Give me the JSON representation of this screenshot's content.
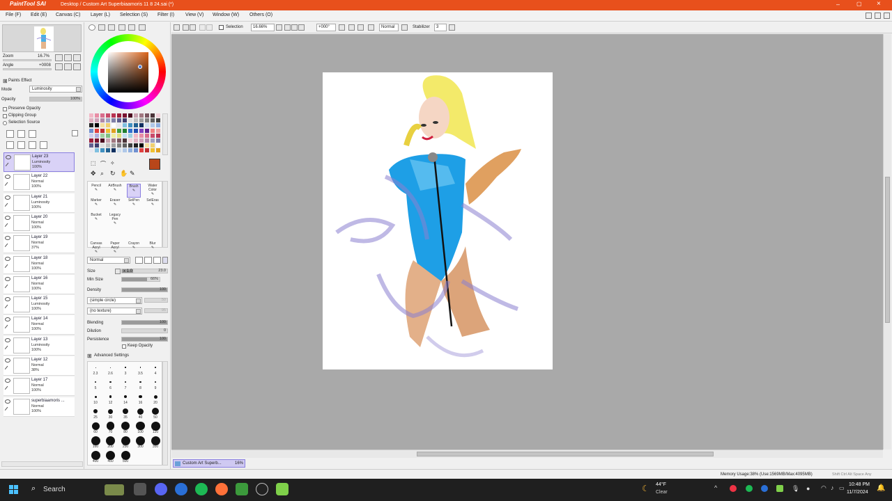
{
  "window": {
    "title": "Desktop / Custom Art Superbiaamoris 11 8 24.sai (*)",
    "logo": "PaintTool SAI"
  },
  "menu": [
    "File (F)",
    "Edit (E)",
    "Canvas (C)",
    "Layer (L)",
    "Selection (S)",
    "Filter (I)",
    "View (V)",
    "Window (W)",
    "Others (O)"
  ],
  "toolbar": {
    "selection_label": "Selection",
    "zoom": "16.66%",
    "angle": "+000°",
    "mode": "Normal",
    "stabilizer_label": "Stabilizer",
    "stabilizer_value": "3"
  },
  "navigator": {
    "zoom_label": "Zoom",
    "zoom_value": "16.7%",
    "angle_label": "Angle",
    "angle_value": "+0008"
  },
  "layer_props": {
    "paints_effect": "Paints Effect",
    "mode_label": "Mode",
    "mode_value": "Luminosity",
    "opacity_label": "Opacity",
    "opacity_value": "100%",
    "preserve_opacity": "Preserve Opacity",
    "clipping_group": "Clipping Group",
    "selection_source": "Selection Source"
  },
  "layers": [
    {
      "name": "Layer 23",
      "mode": "Luminosity",
      "opacity": "100%"
    },
    {
      "name": "Layer 22",
      "mode": "Normal",
      "opacity": "100%"
    },
    {
      "name": "Layer 21",
      "mode": "Luminosity",
      "opacity": "100%"
    },
    {
      "name": "Layer 20",
      "mode": "Normal",
      "opacity": "100%"
    },
    {
      "name": "Layer 19",
      "mode": "Normal",
      "opacity": "37%"
    },
    {
      "name": "Layer 18",
      "mode": "Normal",
      "opacity": "100%"
    },
    {
      "name": "Layer 16",
      "mode": "Normal",
      "opacity": "100%"
    },
    {
      "name": "Layer 15",
      "mode": "Luminosity",
      "opacity": "100%"
    },
    {
      "name": "Layer 14",
      "mode": "Normal",
      "opacity": "100%"
    },
    {
      "name": "Layer 13",
      "mode": "Luminosity",
      "opacity": "100%"
    },
    {
      "name": "Layer 12",
      "mode": "Normal",
      "opacity": "38%"
    },
    {
      "name": "Layer 17",
      "mode": "Normal",
      "opacity": "100%"
    },
    {
      "name": "superbiaamoris ...",
      "mode": "Normal",
      "opacity": "100%"
    }
  ],
  "tools": {
    "row1": [
      "Pencil",
      "AirBrush",
      "Brush",
      "Water Color"
    ],
    "row2": [
      "Marker",
      "Eraser",
      "SelPen",
      "SelEras"
    ],
    "row3": [
      "Bucket",
      "Legacy Pen"
    ],
    "row4": [
      "Canvas Acryl",
      "Paper Acryl",
      "Crayon",
      "Blur"
    ]
  },
  "brush": {
    "blend_mode": "Normal",
    "size_label": "Size",
    "size_mult": "x 1.0",
    "size_value": "23.0",
    "min_size_label": "Min Size",
    "min_size_value": "66%",
    "density_label": "Density",
    "density_value": "100",
    "shape": "(simple circle)",
    "shape_value": "50",
    "texture": "(no texture)",
    "texture_value": "95",
    "blending_label": "Blending",
    "blending_value": "100",
    "dilution_label": "Dilution",
    "dilution_value": "0",
    "persistence_label": "Persistence",
    "persistence_value": "100",
    "keep_opacity": "Keep Opacity",
    "advanced": "Advanced Settings"
  },
  "brush_sizes": [
    "2.3",
    "2.6",
    "3",
    "3.5",
    "4",
    "5",
    "6",
    "7",
    "8",
    "9",
    "10",
    "12",
    "14",
    "16",
    "20",
    "25",
    "30",
    "35",
    "40",
    "50",
    "60",
    "70",
    "80",
    "100",
    "120",
    "160",
    "200",
    "250",
    "300",
    "350",
    "400",
    "450",
    "500"
  ],
  "document_tab": {
    "name": "Custom Art Superb...",
    "zoom": "16%"
  },
  "status": {
    "memory": "Memory Usage:38% (Use:1569MB/Max:4095MB)",
    "keys": "Shift Ctrl Alt Space Any"
  },
  "taskbar": {
    "search": "Search",
    "weather_temp": "44°F",
    "weather_desc": "Clear",
    "time": "10:48 PM",
    "date": "11/7/2024"
  }
}
